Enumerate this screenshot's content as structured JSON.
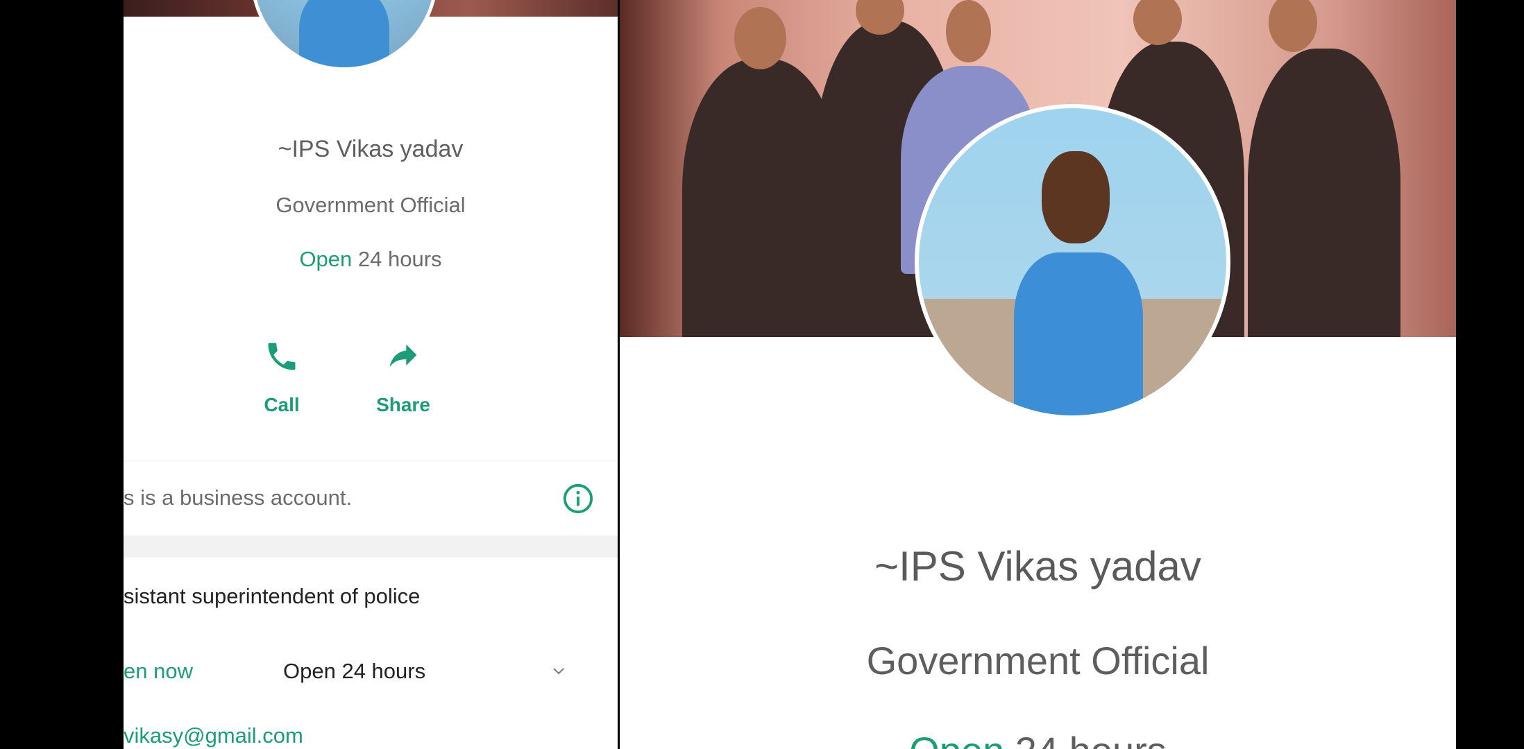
{
  "left_profile": {
    "name": "~IPS Vikas yadav",
    "category": "Government Official",
    "hours_status": "Open",
    "hours_text": " 24 hours",
    "actions": {
      "call_label": "Call",
      "share_label": "Share"
    },
    "business_notice": "s is a business account.",
    "job_title": "sistant superintendent of police",
    "open_now_label": "en now",
    "open_hours": "Open 24 hours",
    "email": "vikasy@gmail.com"
  },
  "right_profile": {
    "name": "~IPS Vikas yadav",
    "category": "Government Official",
    "hours_status": "Open",
    "hours_text": " 24 hours"
  },
  "colors": {
    "accent_green": "#1a9d78",
    "text_gray": "#6b6b6b",
    "background": "#000000"
  },
  "icons": [
    "phone-icon",
    "share-arrow-icon",
    "info-icon",
    "chevron-down-icon"
  ]
}
